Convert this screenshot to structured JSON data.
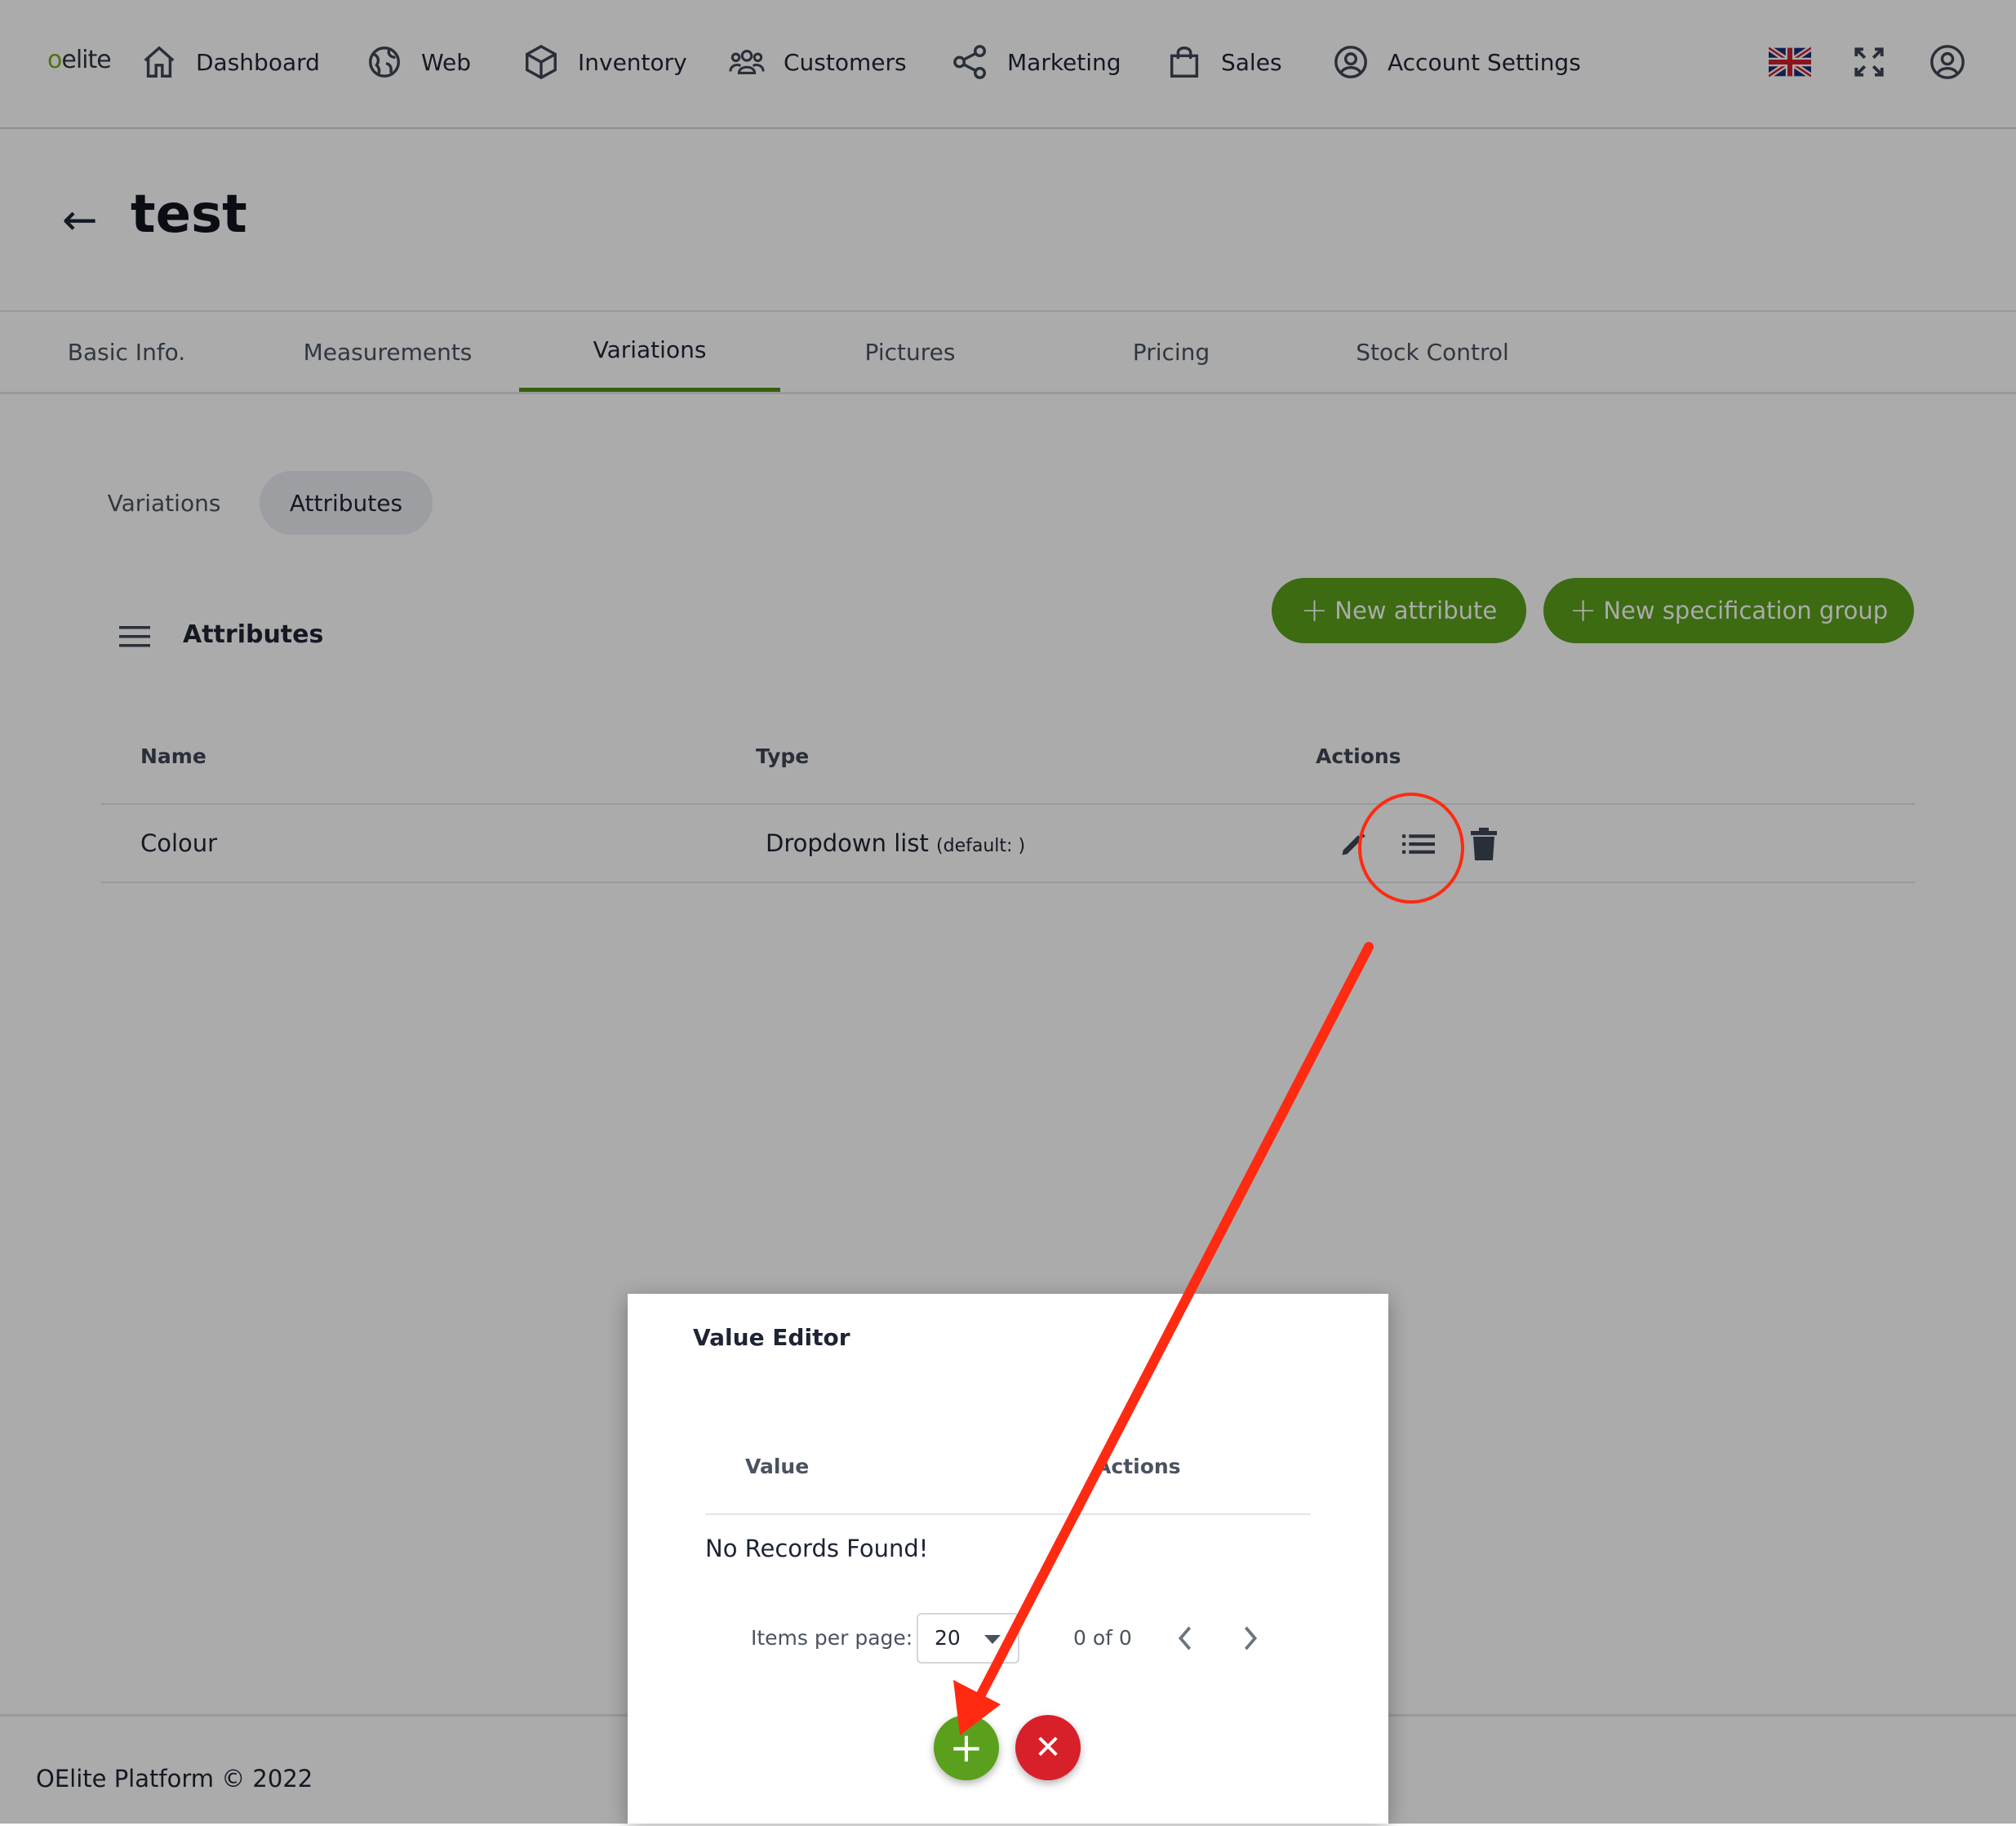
{
  "brand": {
    "logo_prefix": "o",
    "logo_rest": "elite"
  },
  "nav": {
    "items": [
      {
        "label": "Dashboard",
        "icon": "home-icon"
      },
      {
        "label": "Web",
        "icon": "globe-icon"
      },
      {
        "label": "Inventory",
        "icon": "box-icon"
      },
      {
        "label": "Customers",
        "icon": "users-icon"
      },
      {
        "label": "Marketing",
        "icon": "share-icon"
      },
      {
        "label": "Sales",
        "icon": "shopping-bag-icon"
      },
      {
        "label": "Account Settings",
        "icon": "user-circle-icon"
      }
    ],
    "right_icons": [
      "uk-flag-icon",
      "fullscreen-icon",
      "profile-icon"
    ]
  },
  "header": {
    "back": "←",
    "title": "test"
  },
  "tabs": [
    "Basic Info.",
    "Measurements",
    "Variations",
    "Pictures",
    "Pricing",
    "Stock Control"
  ],
  "active_tab": "Variations",
  "subtabs": [
    "Variations",
    "Attributes"
  ],
  "active_subtab": "Attributes",
  "card": {
    "title": "Attributes",
    "new_attribute": "New attribute",
    "new_spec_group": "New specification group",
    "columns": [
      "Name",
      "Type",
      "Actions"
    ],
    "rows": [
      {
        "name": "Colour",
        "type": "Dropdown list",
        "type_note": "(default: )",
        "actions": [
          "edit-icon",
          "list-icon",
          "trash-icon"
        ]
      }
    ]
  },
  "footer": {
    "text": "OElite Platform © 2022"
  },
  "dialog": {
    "title": "Value Editor",
    "columns": [
      "Value",
      "Actions"
    ],
    "empty": "No Records Found!",
    "items_per_page_label": "Items per page:",
    "items_per_page": "20",
    "range": "0 of 0",
    "add_symbol": "+",
    "close_symbol": "✕"
  },
  "colors": {
    "accent_green": "#5aa01c",
    "tab_underline": "#4f8c14",
    "danger_red": "#d8202a",
    "annotation_red": "#ff2a12"
  }
}
